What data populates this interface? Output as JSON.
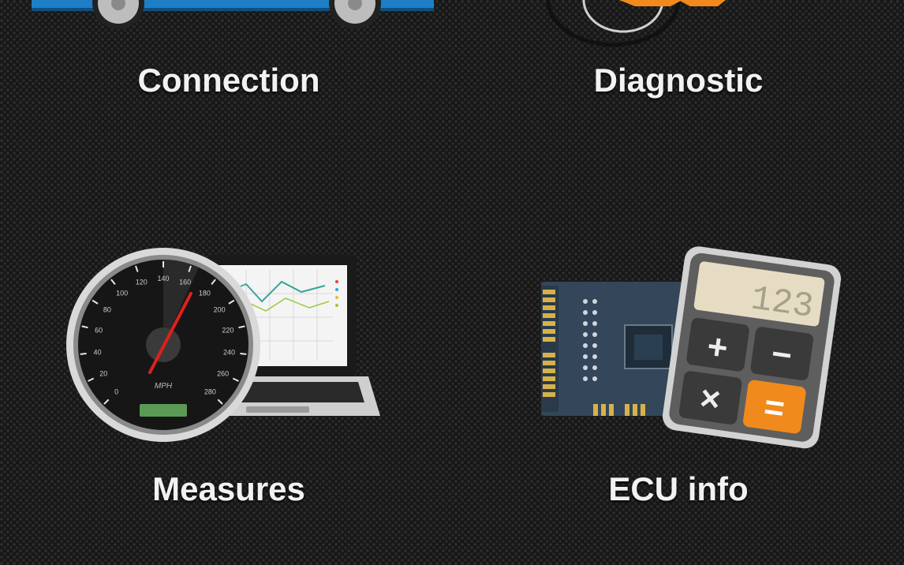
{
  "menu": {
    "connection": {
      "label": "Connection",
      "icon": "car-icon"
    },
    "diagnostic": {
      "label": "Diagnostic",
      "icon": "diagnostic-gauge-icon"
    },
    "measures": {
      "label": "Measures",
      "icon": "speedometer-laptop-icon"
    },
    "ecu_info": {
      "label": "ECU info",
      "icon": "circuit-calculator-icon"
    }
  },
  "speedometer": {
    "unit": "MPH",
    "ticks": [
      "0",
      "20",
      "40",
      "60",
      "80",
      "100",
      "120",
      "140",
      "160",
      "180",
      "200",
      "220",
      "240",
      "260",
      "280"
    ]
  },
  "calculator": {
    "display": "123",
    "keys": [
      "+",
      "−",
      "×",
      "="
    ]
  },
  "colors": {
    "background": "#1e1e1e",
    "label": "#f2f2f2",
    "car_body": "#1e7fc6",
    "accent_orange": "#f08a1c",
    "needle": "#e0201c",
    "pcb": "#33465a"
  }
}
